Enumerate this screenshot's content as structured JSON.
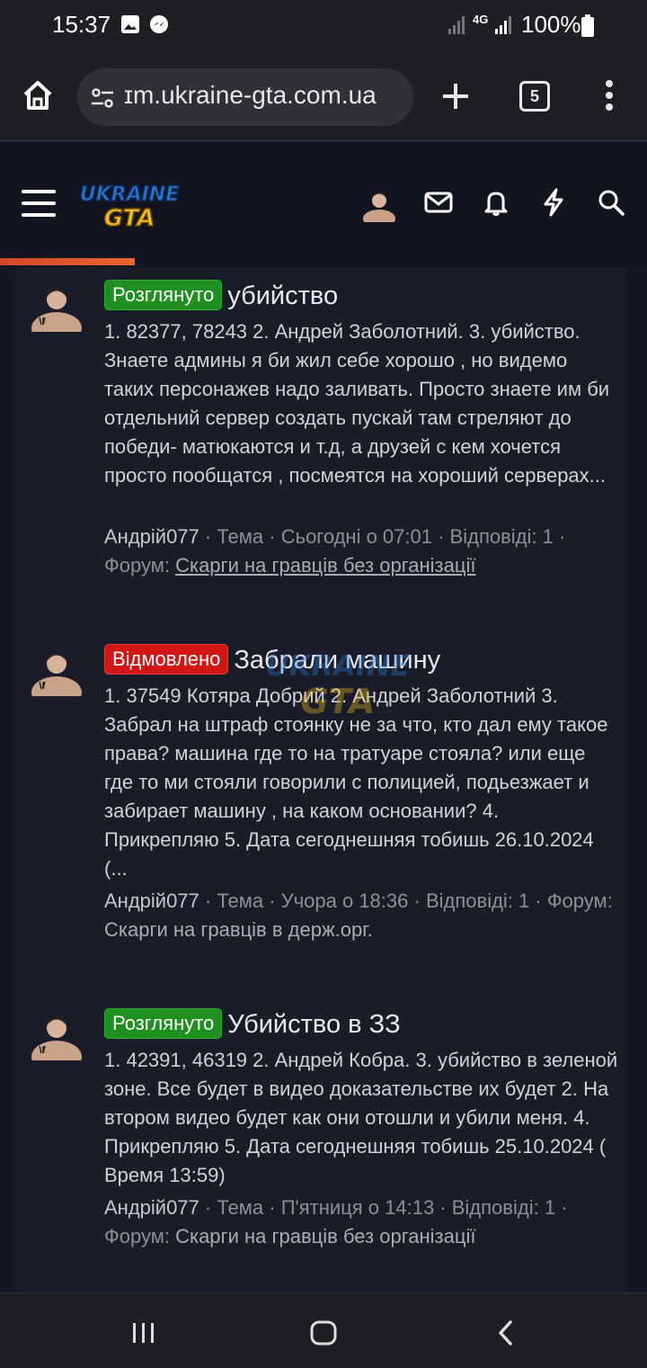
{
  "status_bar": {
    "time": "15:37",
    "network": "4G",
    "battery": "100%",
    "icons": [
      "image-icon",
      "messenger-icon",
      "signal-icon",
      "wifi-signal-icon",
      "battery-icon"
    ]
  },
  "browser": {
    "url": "ɪm.ukraine-gta.com.ua",
    "tab_count": "5",
    "icons": [
      "home-icon",
      "site-settings-icon",
      "new-tab-icon",
      "tabs-icon",
      "more-menu-icon"
    ]
  },
  "site_header": {
    "logo_text_top": "UKRAINE",
    "logo_text_bottom": "GTA",
    "icons": [
      "menu-icon",
      "avatar",
      "mail-icon",
      "bell-icon",
      "lightning-icon",
      "search-icon"
    ],
    "colors": {
      "progress": "#e9652d"
    }
  },
  "posts": [
    {
      "badge": "Розглянуто",
      "badge_color": "#1f8f1f",
      "title": "убийство",
      "snippet": "1. 82377, 78243 2. Андрей Заболотний. 3. убийство. Знаете админы я би жил себе хорошо , но видемо таких персонажев надо заливать. Просто знаете им би отдельний сервер создать пускай там стреляют до победи- матюкаются и т.д, а друзей с кем хочется просто пообщатся , посмеятся на хороший серверах...",
      "author": "Андрій077",
      "type": "Тема",
      "date": "Сьогодні о 07:01",
      "replies": "Відповіді: 1",
      "forum_label": "Форум:",
      "forum": "Скарги на гравців без організації"
    },
    {
      "badge": "Відмовлено",
      "badge_color": "#d21616",
      "title": "Забрали машину",
      "snippet": "1. 37549 Котяра Добрий 2. Андрей Заболотний 3. Забрал на штраф стоянку не за что, кто дал ему такое права? машина где то на тратуаре стояла? или еще где то ми стояли говорили с полицией, подьезжает и забирает машину , на каком основании? 4. Прикрепляю 5. Дата сегоднешняя тобишь 26.10.2024 (...",
      "author": "Андрій077",
      "type": "Тема",
      "date": "Учора о 18:36",
      "replies": "Відповіді: 1",
      "forum_label": "Форум:",
      "forum": "Скарги на гравців в держ.орг."
    },
    {
      "badge": "Розглянуто",
      "badge_color": "#1f8f1f",
      "title": "Убийство в ЗЗ",
      "snippet": "1. 42391, 46319 2. Андрей Кобра. 3. убийство в зеленой зоне. Все будет в видео доказательстве их будет 2. На втором видео будет как они отошли и убили меня. 4. Прикрепляю 5. Дата сегоднешняя тобишь 25.10.2024 ( Время 13:59)",
      "author": "Андрій077",
      "type": "Тема",
      "date": "П'ятниця о 14:13",
      "replies": "Відповіді: 1",
      "forum_label": "Форум:",
      "forum": "Скарги на гравців без організації"
    }
  ],
  "navbar": {
    "icons": [
      "recent-apps-icon",
      "home-button-icon",
      "back-icon"
    ]
  }
}
